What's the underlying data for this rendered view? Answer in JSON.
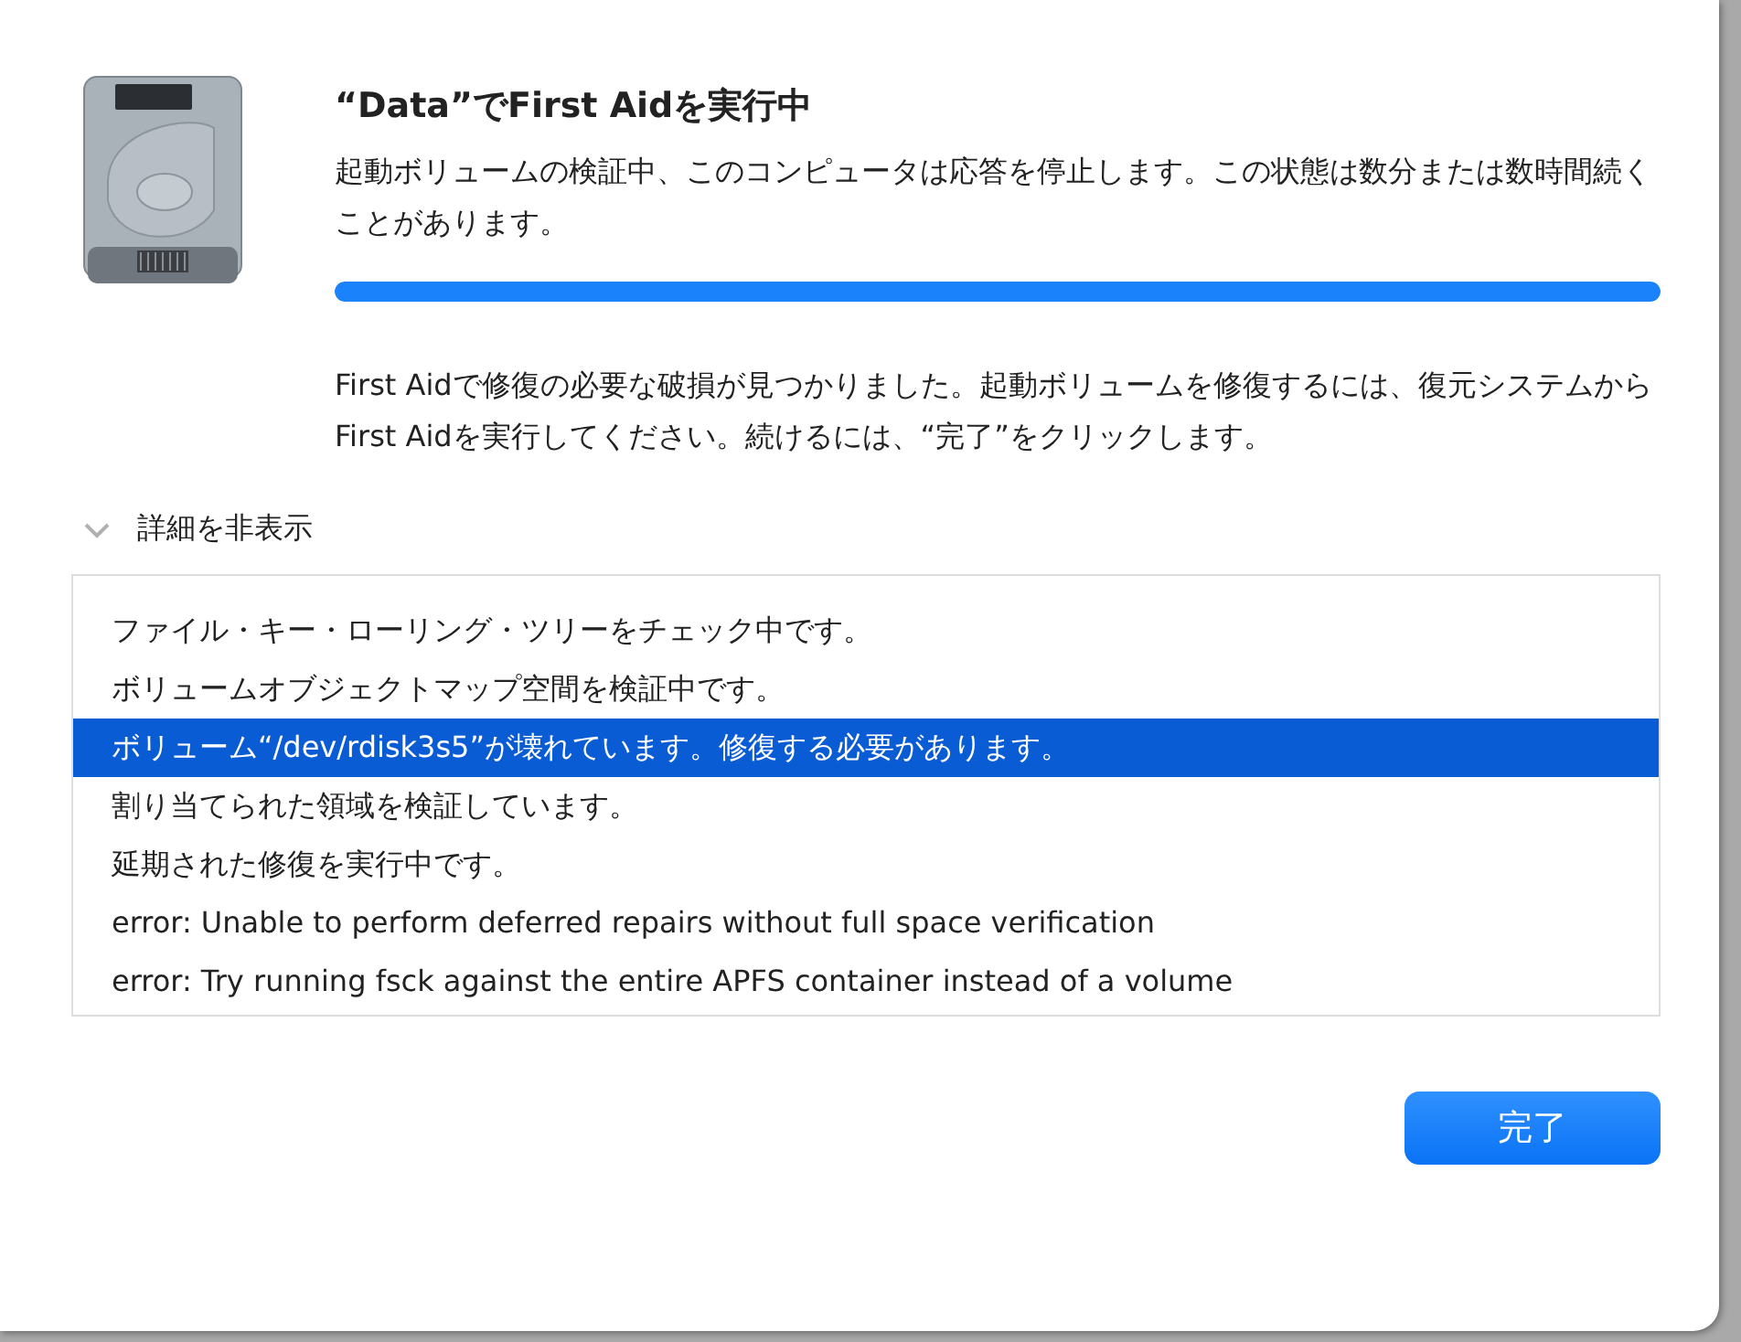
{
  "dialog": {
    "title": "“Data”でFirst Aidを実行中",
    "message": "起動ボリュームの検証中、このコンピュータは応答を停止します。この状態は数分または数時間続くことがあります。",
    "progress": {
      "level": 1
    },
    "result": "First Aidで修復の必要な破損が見つかりました。起動ボリュームを修復するには、復元システムからFirst Aidを実行してください。続けるには、“完了”をクリックします。",
    "details_toggle": {
      "label": "詳細を非表示",
      "expanded": true
    },
    "log": [
      {
        "text": "ファイル・キー・ローリング・ツリーをチェック中です。",
        "selected": false
      },
      {
        "text": "ボリュームオブジェクトマップ空間を検証中です。",
        "selected": false
      },
      {
        "text": "ボリューム“/dev/rdisk3s5”が壊れています。修復する必要があります。",
        "selected": true
      },
      {
        "text": "割り当てられた領域を検証しています。",
        "selected": false
      },
      {
        "text": "延期された修復を実行中です。",
        "selected": false
      },
      {
        "text": "error: Unable to perform deferred repairs without full space verification",
        "selected": false
      },
      {
        "text": "error: Try running fsck against the entire APFS container instead of a volume",
        "selected": false
      }
    ],
    "buttons": [
      {
        "label": "完了",
        "kind": "default"
      }
    ]
  }
}
